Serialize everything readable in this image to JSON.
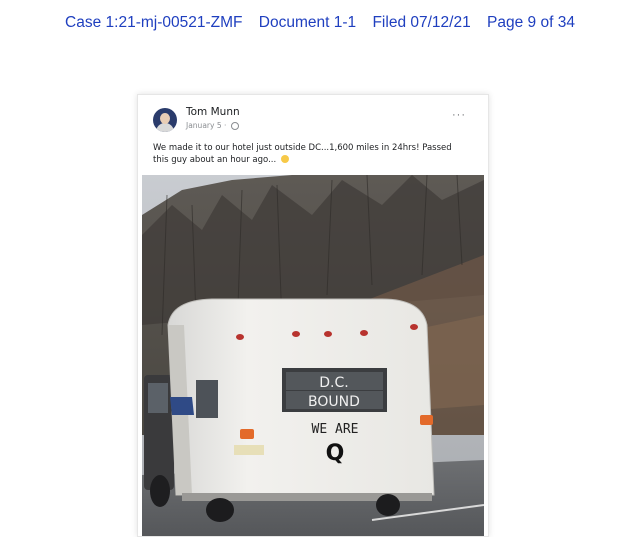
{
  "header": {
    "case_no": "Case 1:21-mj-00521-ZMF",
    "document": "Document 1-1",
    "filed": "Filed 07/12/21",
    "page": "Page 9 of 34"
  },
  "post": {
    "author": "Tom Munn",
    "date": "January 5 ·",
    "more": "···",
    "caption_line1": "We made it to our hotel just outside DC...1,600 miles in 24hrs!  Passed",
    "caption_line2": "this guy about an hour ago...",
    "icons": {
      "avatar": "user-photo",
      "audience": "globe-icon",
      "emoji": "smile-emoji",
      "menu": "more-options-icon"
    }
  },
  "photo": {
    "sign_line1": "D.C.",
    "sign_line2": "BOUND",
    "trailer_text1": "WE ARE",
    "trailer_text2": "Q"
  }
}
